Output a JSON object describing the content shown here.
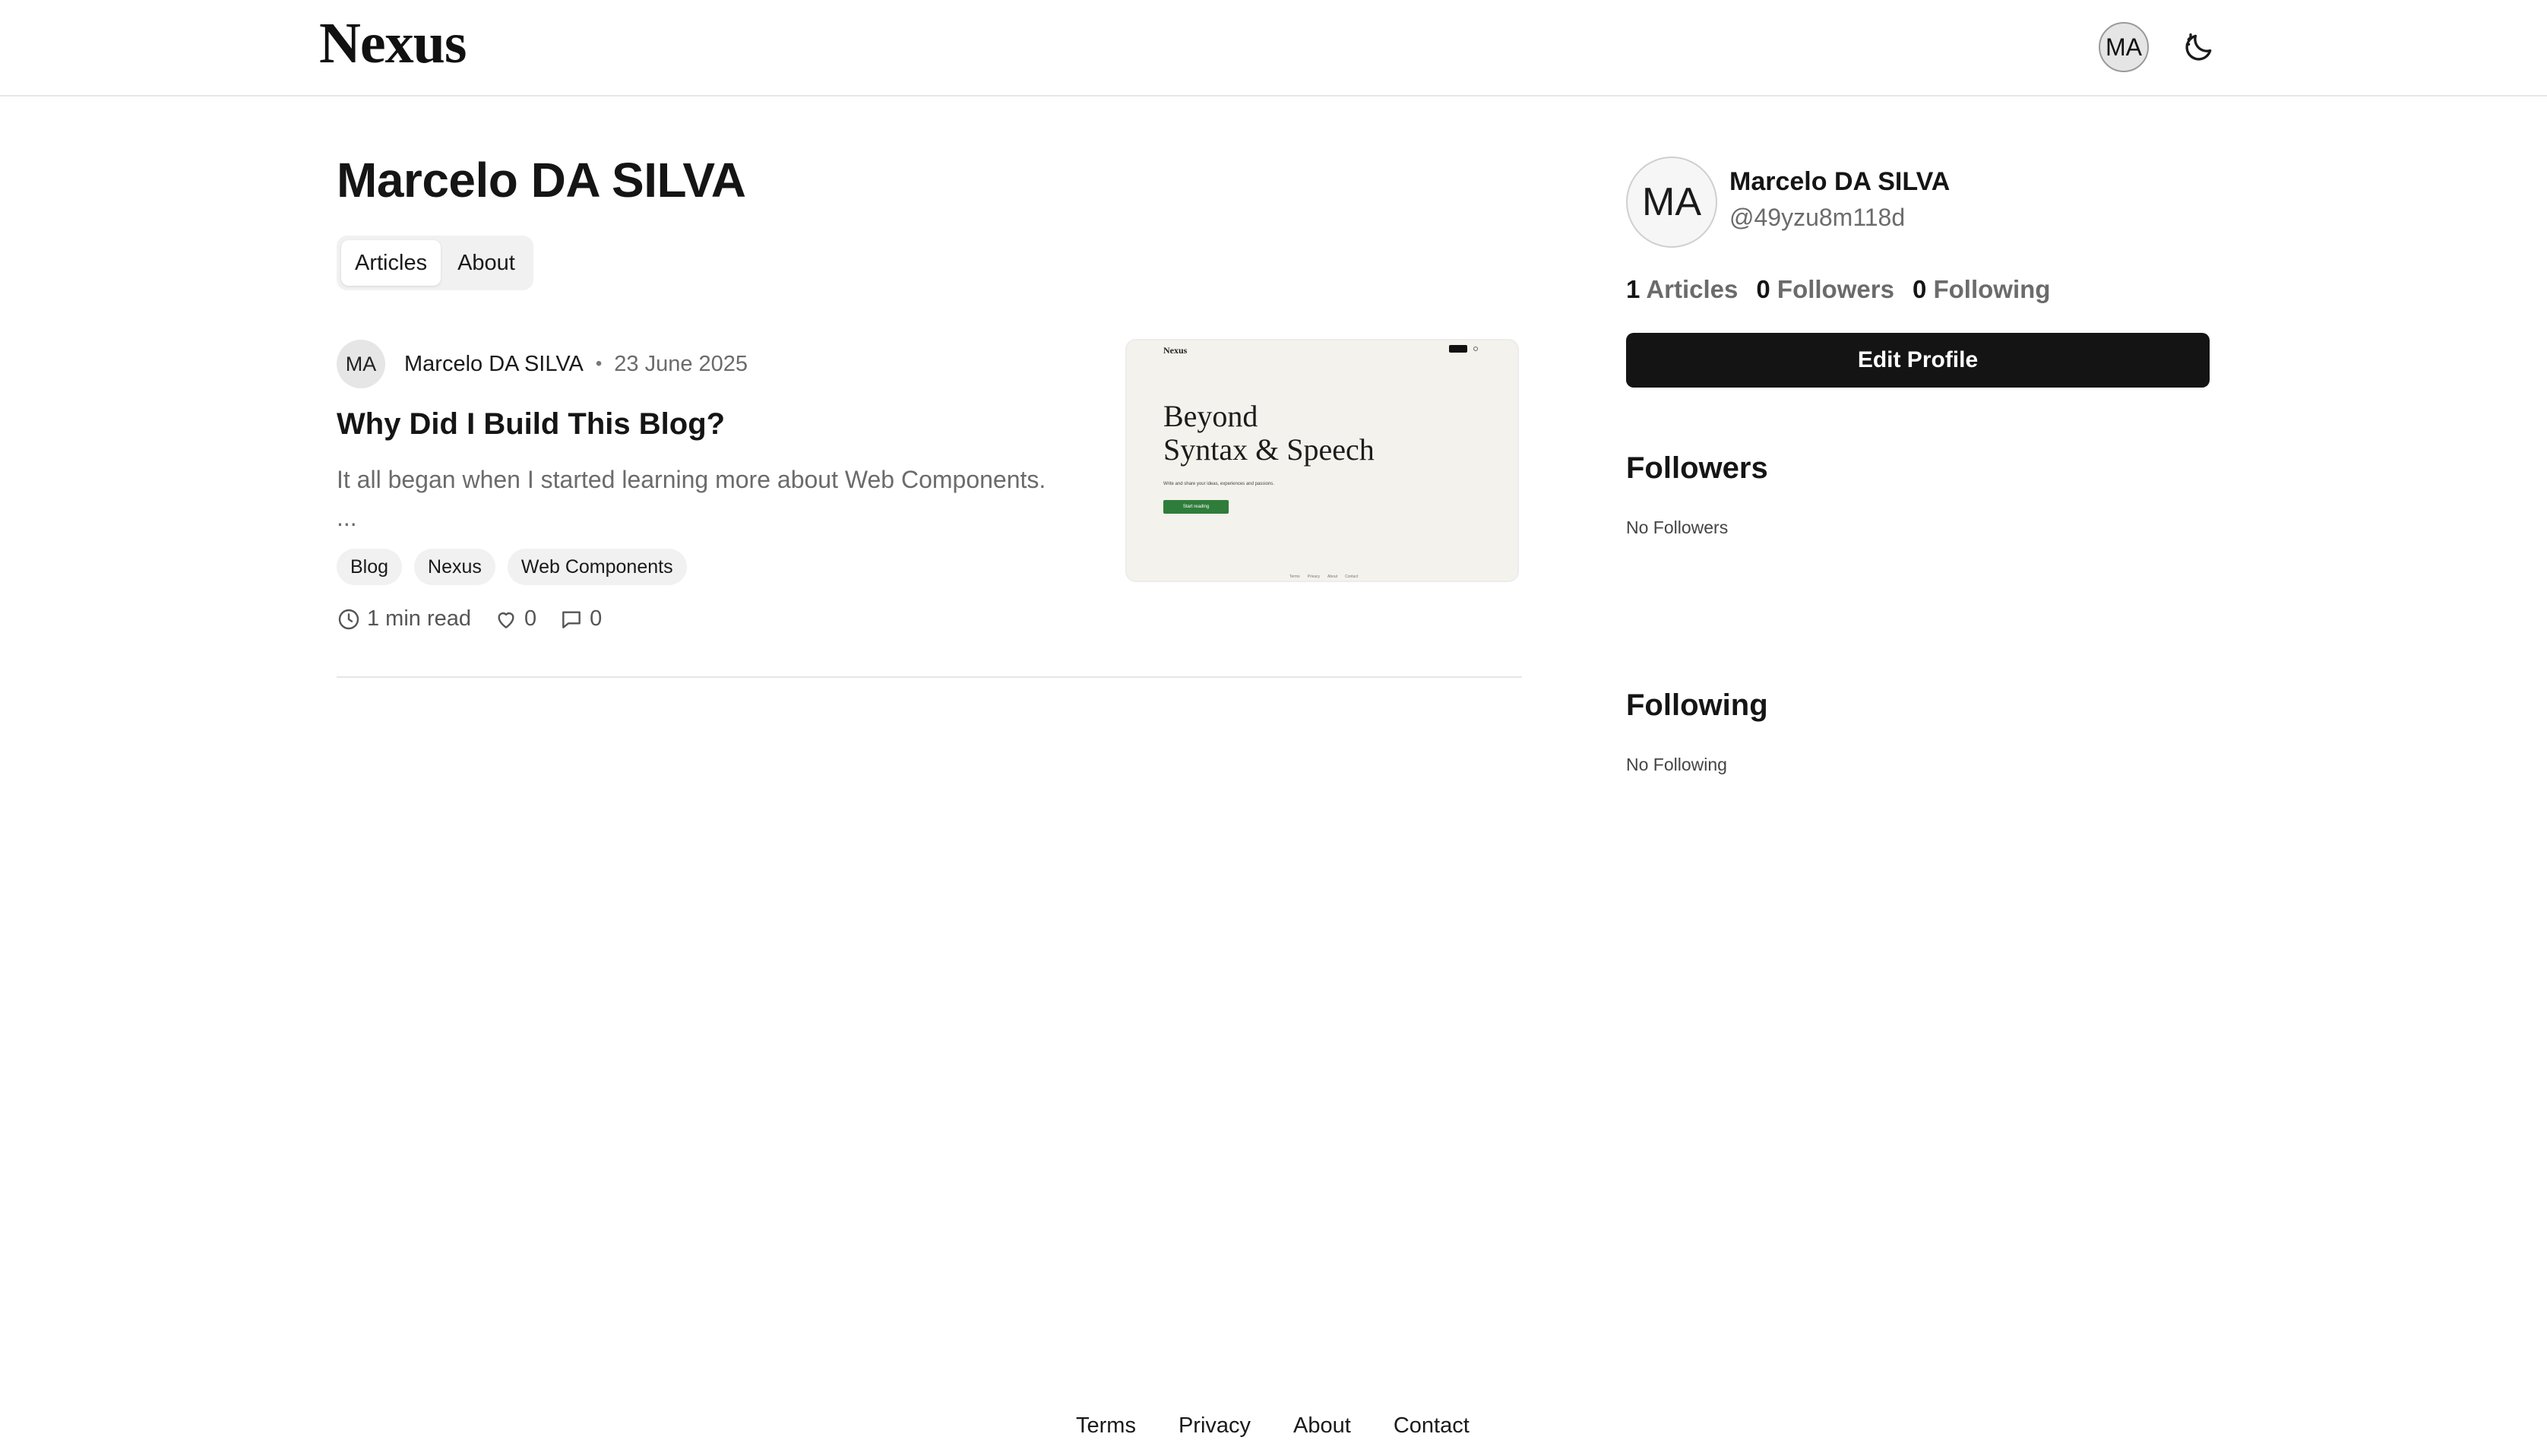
{
  "header": {
    "logo": "Nexus",
    "avatar_initials": "MA",
    "theme_icon": "moon-icon"
  },
  "profile": {
    "title": "Marcelo DA SILVA",
    "tabs": [
      {
        "label": "Articles",
        "active": true
      },
      {
        "label": "About",
        "active": false
      }
    ]
  },
  "article": {
    "author_initials": "MA",
    "author": "Marcelo DA SILVA",
    "separator": "•",
    "date": "23 June 2025",
    "title": "Why Did I Build This Blog?",
    "excerpt_line1": "It all began when I started learning more about Web Components.",
    "excerpt_line2": "...",
    "tags": [
      "Blog",
      "Nexus",
      "Web Components"
    ],
    "read_time": "1 min read",
    "likes": "0",
    "comments": "0",
    "thumbnail": {
      "logo": "Nexus",
      "heading_line1": "Beyond",
      "heading_line2": "Syntax & Speech",
      "tagline": "Write and share your ideas, experiences and passions.",
      "cta": "Start reading",
      "cta_color": "#2f7d3a"
    }
  },
  "sidebar": {
    "avatar_initials": "MA",
    "name": "Marcelo DA SILVA",
    "handle": "@49yzu8m118d",
    "counts": [
      {
        "num": "1",
        "label": "Articles"
      },
      {
        "num": "0",
        "label": "Followers"
      },
      {
        "num": "0",
        "label": "Following"
      }
    ],
    "edit_label": "Edit Profile",
    "followers_title": "Followers",
    "followers_empty": "No Followers",
    "following_title": "Following",
    "following_empty": "No Following"
  },
  "footer": {
    "links": [
      "Terms",
      "Privacy",
      "About",
      "Contact"
    ]
  }
}
